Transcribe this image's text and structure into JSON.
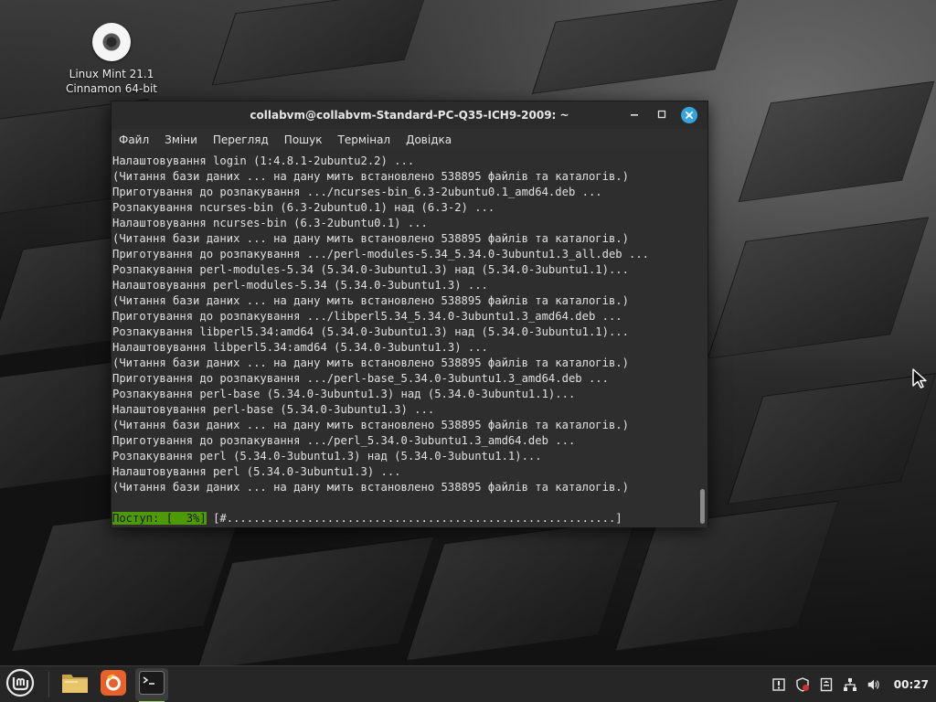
{
  "desktop": {
    "icon": {
      "name": "disc-icon",
      "label_line1": "Linux Mint 21.1",
      "label_line2": "Cinnamon 64-bit"
    }
  },
  "window": {
    "title": "collabvm@collabvm-Standard-PC-Q35-ICH9-2009: ~",
    "controls": {
      "minimize": "−",
      "maximize": "□",
      "close": "✕"
    },
    "menu": [
      "Файл",
      "Зміни",
      "Перегляд",
      "Пошук",
      "Термінал",
      "Довідка"
    ]
  },
  "terminal": {
    "lines": [
      "Налаштовування login (1:4.8.1-2ubuntu2.2) ...",
      "(Читання бази даних ... на дану мить встановлено 538895 файлів та каталогів.)",
      "Приготування до розпакування .../ncurses-bin_6.3-2ubuntu0.1_amd64.deb ...",
      "Розпакування ncurses-bin (6.3-2ubuntu0.1) над (6.3-2) ...",
      "Налаштовування ncurses-bin (6.3-2ubuntu0.1) ...",
      "(Читання бази даних ... на дану мить встановлено 538895 файлів та каталогів.)",
      "Приготування до розпакування .../perl-modules-5.34_5.34.0-3ubuntu1.3_all.deb ...",
      "Розпакування perl-modules-5.34 (5.34.0-3ubuntu1.3) над (5.34.0-3ubuntu1.1)...",
      "Налаштовування perl-modules-5.34 (5.34.0-3ubuntu1.3) ...",
      "(Читання бази даних ... на дану мить встановлено 538895 файлів та каталогів.)",
      "Приготування до розпакування .../libperl5.34_5.34.0-3ubuntu1.3_amd64.deb ...",
      "Розпакування libperl5.34:amd64 (5.34.0-3ubuntu1.3) над (5.34.0-3ubuntu1.1)...",
      "Налаштовування libperl5.34:amd64 (5.34.0-3ubuntu1.3) ...",
      "(Читання бази даних ... на дану мить встановлено 538895 файлів та каталогів.)",
      "Приготування до розпакування .../perl-base_5.34.0-3ubuntu1.3_amd64.deb ...",
      "Розпакування perl-base (5.34.0-3ubuntu1.3) над (5.34.0-3ubuntu1.1)...",
      "Налаштовування perl-base (5.34.0-3ubuntu1.3) ...",
      "(Читання бази даних ... на дану мить встановлено 538895 файлів та каталогів.)",
      "Приготування до розпакування .../perl_5.34.0-3ubuntu1.3_amd64.deb ...",
      "Розпакування perl (5.34.0-3ubuntu1.3) над (5.34.0-3ubuntu1.1)...",
      "Налаштовування perl (5.34.0-3ubuntu1.3) ...",
      "(Читання бази даних ... на дану мить встановлено 538895 файлів та каталогів.)"
    ],
    "progress_label": "Поступ: [  3%]",
    "progress_bar": " [#..........................................................]",
    "progress_percent": 3
  },
  "taskbar": {
    "menu_icon": "linux-mint-logo-icon",
    "apps": [
      {
        "name": "files",
        "icon": "folder-icon"
      },
      {
        "name": "firefox",
        "icon": "firefox-icon"
      },
      {
        "name": "terminal",
        "icon": "terminal-icon",
        "active": true
      }
    ],
    "tray": [
      "update-manager-icon",
      "shield-icon",
      "removable-drive-icon",
      "network-icon",
      "volume-icon"
    ],
    "clock": "00:27"
  },
  "colors": {
    "progress_green": "#4e9a06",
    "close_button_blue": "#35a4dd",
    "terminal_bg": "#2e2e2e"
  }
}
